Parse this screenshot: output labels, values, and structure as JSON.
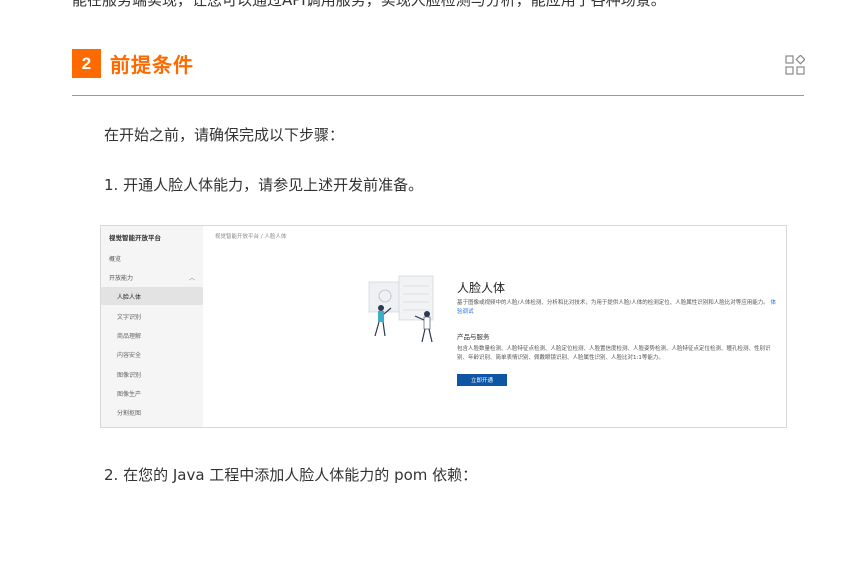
{
  "top_text": "能在服务端实现，让您可以通过API调用服务，实现人脸检测与分析，能应用于各种场景。",
  "section": {
    "number": "2",
    "title": "前提条件"
  },
  "intro": "在开始之前，请确保完成以下步骤：",
  "step1": "1. 开通人脸人体能力，请参见上述开发前准备。",
  "step2": "2. 在您的 Java 工程中添加人脸人体能力的 pom 依赖：",
  "screenshot": {
    "sidebar": {
      "title": "视觉智能开放平台",
      "items": [
        "概览",
        "开放能力"
      ],
      "sub_items": [
        "人脸人体",
        "文字识别",
        "商品理解",
        "内容安全",
        "图像识别",
        "图像生产",
        "分割抠图"
      ],
      "active": "人脸人体"
    },
    "breadcrumb": "视觉智能开放平台 / 人脸人体",
    "card": {
      "title": "人脸人体",
      "desc": "基于图像或视频中的人脸/人体检测、分析和比对技术，为用于提供人脸/人体的检测定位、人脸属性识别和人脸比对等应用能力。",
      "link": "体验调试",
      "products_heading": "产品与服务",
      "products_text": "包含人脸数量检测、人脸特征点检测、人脸定位检测、人脸置信度检测、人脸姿势检测、人脸特征点定位检测、瞳孔检测、性别识别、年龄识别、简单表情识别、佩戴眼镜识别、人脸属性识别、人脸比对1:1等能力。",
      "button": "立即开通"
    }
  },
  "colors": {
    "accent": "#ff6a00",
    "button": "#0e56a4",
    "link": "#1f6fd6"
  }
}
